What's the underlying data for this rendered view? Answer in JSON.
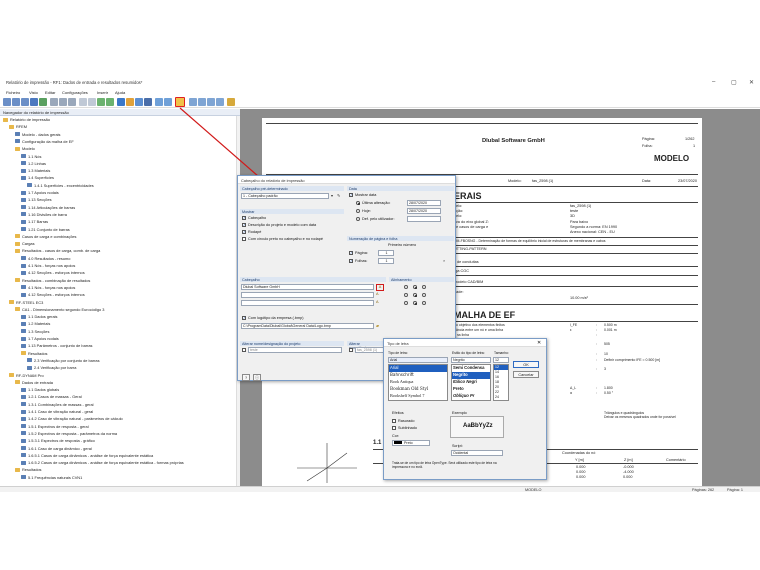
{
  "window": {
    "title": "Relatório de impressão - RF1: Dados de entrada e resultados resumidos*",
    "controls": [
      "–",
      "▢",
      "✕"
    ]
  },
  "menu": [
    "Ficheiro",
    "Visto",
    "Editar",
    "Configurações",
    "Inserir",
    "Ajuda"
  ],
  "navigator": {
    "header": "Navegador do relatório de impressão",
    "items": [
      "Relatório de impressão",
      "RFEM",
      "Modelo - dados gerais",
      "Configuração da malha de EF",
      "Modelo",
      "1.1 Nós",
      "1.2 Linhas",
      "1.3 Materiais",
      "1.4 Superfícies",
      "1.4.1 Superfícies - excentricidades",
      "1.7 Apoios nodais",
      "1.13 Secções",
      "1.14 Articulações de barras",
      "1.16 Divisões de barra",
      "1.17 Barras",
      "1.21 Conjunto de barras",
      "Casos de carga e combinações",
      "Cargas",
      "Resultados - casos de carga, comb. de carga",
      "4.0 Resultados - resumo",
      "4.1 Nós - forças nos apoios",
      "4.12 Secções - esforços internos",
      "Resultados - combinação de resultados",
      "4.1 Nós - forças nos apoios",
      "4.12 Secções - esforços internos",
      "RF-STEEL EC3",
      "CA1 - Dimensionamento segundo Eurocódigo 3",
      "1.1 Dados gerais",
      "1.2 Materiais",
      "1.3 Secções",
      "1.7 Apoios nodais",
      "1.13 Parâmetros - conjunto de barras",
      "Resultados",
      "2.3 Verificação por conjunto de barras",
      "2.4 Verificação por barra",
      "RF-DYNAM Pro",
      "Dados de entrada",
      "1.1 Dados globais",
      "1.2.1 Casos de massas - Geral",
      "1.3.1 Combinações de massas - geral",
      "1.4.1 Caso de vibração natural - geral",
      "1.4.2 Caso de vibração natural - parâmetros de cálculo",
      "1.5.1 Espectros de resposta - geral",
      "1.5.2 Espectros de resposta - parâmetros da norma",
      "1.5.3.1 Espectros de resposta - gráfico",
      "1.6.1 Caso de carga dinâmico - geral",
      "1.6.5.1 Casos de carga dinâmicos - análise de força equivalente estática",
      "1.6.5.2 Casos de carga dinâmicos - análise de força equivalente estática - formas próprias",
      "Resultados",
      "5.1 Frequências naturais CVN1"
    ]
  },
  "report_page": {
    "company": "Dlubal Software GmbH",
    "page_label": "Página:",
    "page_value": "1/262",
    "sheet_label": "Folha:",
    "sheet_value": "1",
    "model_badge": "MODELO",
    "model_label": "Modelo:",
    "model_value": "fas_2598 (1)",
    "date_label": "Data:",
    "date_value": "23/07/2020",
    "heading_general": "ERAIS",
    "rows": [
      [
        "delo:",
        "fas_2598 (1)"
      ],
      [
        "rição:",
        "teste"
      ],
      [
        "delo:",
        "3D"
      ],
      [
        "tiva do eixo global Z:",
        "Para baixo"
      ],
      [
        "de casos de carga e",
        "Segundo a norma: EN 1990"
      ],
      [
        "",
        "Anexo nacional: CEN - EU"
      ]
    ],
    "line_form": "RM-FBOSNG - Determinação de formas de equilíbrio inicial de estruturas de membranas e cabos",
    "line_cutting": "UTTING-PATTERN",
    "line_ctg": "s de conduítas",
    "line_cgc": "rga CGC",
    "line_cadrem": "modelo CAD/BIM",
    "line_gravity": "dade:",
    "gravity_value": "10.00 m/s²",
    "heading_mesh": "MALHA DE EF",
    "mesh_rows": [
      [
        "do objetivo dos elementos finitos",
        "l_FE",
        ":",
        "0.500 m"
      ],
      [
        "dância entre um nó e uma linha",
        "ε",
        ":",
        "0.001 m"
      ],
      [
        "s na linha",
        "",
        ":",
        ""
      ],
      [
        "",
        "",
        ":",
        "505"
      ],
      [
        "",
        "",
        ":",
        "10"
      ],
      [
        "",
        "",
        ":",
        "Definir comprimento lFE = 0.500 [m]"
      ],
      [
        "",
        "",
        ":",
        "3"
      ],
      [
        "",
        "Δ_L",
        ":",
        "1.800"
      ],
      [
        "",
        "α",
        ":",
        "0.50 °"
      ]
    ],
    "mesh_note": "Triângulos e quadrângulos\nDeixar os mesmos quadrados onde for possível",
    "section_11": "1.1",
    "coord_header": "Coordenadas do nó",
    "coord_cols": [
      "Y [m]",
      "Z [m]",
      "Comentário"
    ],
    "coord_rows": [
      [
        "0.000",
        "-0.000"
      ],
      [
        "0.000",
        "-4.000"
      ],
      [
        "0.000",
        "0.000"
      ]
    ],
    "model_footer": "MODELO",
    "pages_status": "Páginas: 262",
    "page_status": "Página: 1"
  },
  "header_dialog": {
    "title": "Cabeçalho do relatório de impressão",
    "group_predefined": "Cabeçalho pré-determinado",
    "predefined_value": "1 - Cabeçalho padrão",
    "group_show": "Mostrar",
    "chk_header": "Cabeçalho",
    "chk_description": "Descrição do projeto e modelo com data",
    "chk_footer": "Rodapé",
    "chk_cover": "Com círculo preto no cabeçalho e no rodapé",
    "group_date": "Data",
    "chk_show_date": "Mostrar data",
    "rad_last_change": "Última alteração:",
    "last_change_value": "28/07/2020",
    "rad_today": "Hoje:",
    "today_value": "28/07/2020",
    "rad_user": "Def. pelo utilizador:",
    "group_numbering": "Numeração de página e folha",
    "first_number": "Primeiro número",
    "chk_page": "Página:",
    "page_num": "1",
    "chk_sheet": "Folhas:",
    "sheet_num": "1",
    "group_header": "Cabeçalho",
    "group_align": "Alinhamento",
    "header_line1": "Dlubal Software GmbH",
    "chk_logo": "Com logótipo da empresa (.bmp)",
    "logo_path": "C:\\ProgramData\\Dlubal\\Global\\General Data\\Logo.bmp",
    "group_change_name": "Alterar nome/designação do projeto",
    "change_name_value": "teste",
    "group_change_model": "Alterar nome/designaç",
    "change_model_value": "fas_2598 (1)"
  },
  "font_dialog": {
    "title": "Tipo de letra",
    "font_label": "Tipo de letra:",
    "style_label": "Estilo do tipo de letra:",
    "size_label": "Tamanho:",
    "font_value": "Arial",
    "style_value": "Negrito",
    "size_value": "12",
    "fonts": [
      "Arial",
      "Bahnschrift",
      "Book Antiqua",
      "Bookman Old Styl",
      "Bookshelf Symbol 7"
    ],
    "styles": [
      "Semi Condensa",
      "Negrito",
      "Itálico Negri",
      "Preto",
      "Oblíquo Pr"
    ],
    "sizes": [
      "12",
      "14",
      "16",
      "18",
      "20",
      "22",
      "24"
    ],
    "ok": "OK",
    "cancel": "Cancelar",
    "effects_label": "Efeitos",
    "strike": "Rasurado",
    "underline": "Sublinhado",
    "color_label": "Cor:",
    "color_value": "Preto",
    "sample_label": "Exemplo",
    "sample_text": "AaBbYyZz",
    "script_label": "Script:",
    "script_value": "Ocidental",
    "info": "Trata-se de um tipo de letra OpenType. Será utilizado este tipo de letra na impressora e no ecrã."
  },
  "colors": {
    "accent": "#1f5fbf",
    "arrow": "#d11a1a",
    "folder": "#e8b84a",
    "table": "#5a7fb5"
  }
}
